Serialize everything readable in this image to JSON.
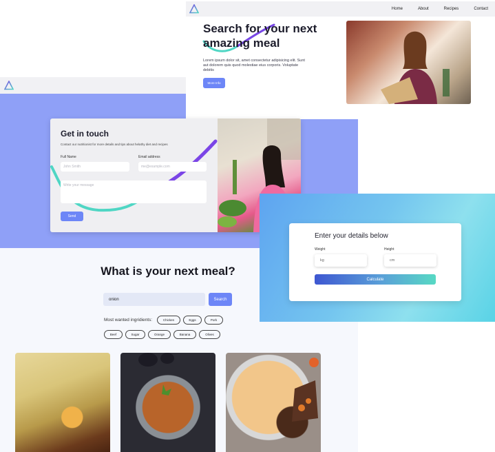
{
  "hero": {
    "nav_links": [
      "Home",
      "About",
      "Recipes",
      "Contact"
    ],
    "headline": "Search for your next amazing meal",
    "lead": "Lorem ipsum dolor sit, amet consectetur adipisicing elit. Sunt aut dolorem quis quod molestiae eius corporis. Voluptate debitis",
    "more_button": "More Info"
  },
  "contact": {
    "title": "Get in touch",
    "description": "Contact our nutritionist for more details and tips about helathy diet and recipes",
    "full_name_label": "Full Name",
    "full_name_placeholder": "John Smith",
    "email_label": "Email address",
    "email_placeholder": "me@example.com",
    "message_placeholder": "Write your message",
    "send_button": "Send"
  },
  "calculator": {
    "title": "Enter your details below",
    "weight_label": "Weight",
    "weight_unit": "kg",
    "height_label": "Height",
    "height_unit": "cm",
    "calculate_button": "Calculate"
  },
  "search": {
    "heading": "What is your next meal?",
    "query": "onion",
    "search_button": "Search",
    "ingredients_label": "Most wanted ingridients:",
    "ingredients": [
      "Chicken",
      "Eggs",
      "Pork",
      "Beef",
      "Sugar",
      "Orange",
      "Banana",
      "Olives"
    ]
  },
  "colors": {
    "accent": "#6d86f7",
    "contact_bg": "#8fa0f7",
    "swoosh_teal": "#4fd6c4",
    "swoosh_purple": "#7b45e6"
  }
}
